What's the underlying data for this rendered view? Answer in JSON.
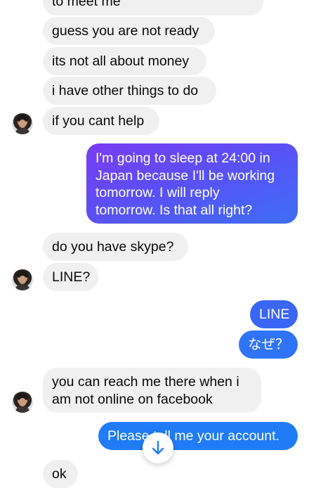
{
  "messages": {
    "m0": "to meet me",
    "m1": "guess you are not ready",
    "m2": "its not all about money",
    "m3": "i have other things to do",
    "m4": "if you cant help",
    "m5_l1": "I'm going to sleep at 24:00 in",
    "m5_l2": "Japan because I'll be working",
    "m5_l3": "tomorrow.  I will reply",
    "m5_l4": "tomorrow.  Is that all right?",
    "m6": "do you have skype?",
    "m7": "LINE?",
    "m8": "LINE",
    "m9": "なぜ？",
    "m10_l1": "you can reach me there when i",
    "m10_l2": "am not online on facebook",
    "m11": "Please tell me your account.",
    "m12": "ok"
  },
  "colors": {
    "incoming_bubble": "#f0f0f0",
    "outgoing_bubble": "#2f7cf6",
    "outgoing_gradient_start": "#7a3cf2"
  },
  "icons": {
    "scroll_down": "arrow-down-icon",
    "avatar": "contact-avatar"
  }
}
